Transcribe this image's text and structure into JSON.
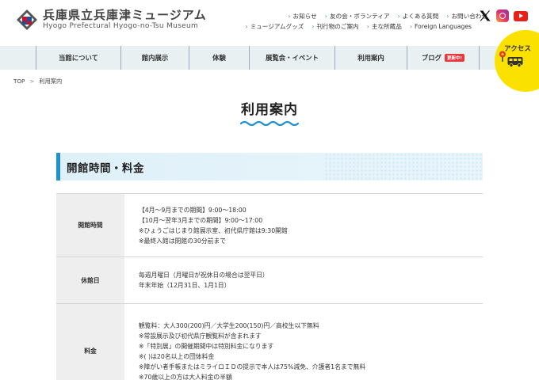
{
  "header": {
    "logo_jp": "兵庫県立兵庫津ミュージアム",
    "logo_en": "Hyogo Prefectural Hyogo-no-Tsu Museum",
    "util_links_row1": [
      "お知らせ",
      "友の会・ボランティア",
      "よくある質問",
      "お問い合わせ"
    ],
    "util_links_row2": [
      "ミュージアムグッズ",
      "刊行物のご案内",
      "主な所蔵品",
      "Foreign Languages"
    ],
    "sns": [
      "x-icon",
      "instagram-icon",
      "youtube-icon"
    ]
  },
  "gnav": {
    "items": [
      "当館について",
      "館内展示",
      "体験",
      "展覧会・イベント",
      "利用案内",
      "ブログ"
    ],
    "blog_badge": "更新中!"
  },
  "access": {
    "label": "アクセス"
  },
  "breadcrumb": {
    "home": "TOP",
    "separator": ">",
    "current": "利用案内"
  },
  "page": {
    "title": "利用案内"
  },
  "section": {
    "title": "開館時間・料金"
  },
  "table": {
    "rows": [
      {
        "label": "開館時間",
        "lines": [
          "【4月〜9月までの期間】9:00〜18:00",
          "【10月〜翌年3月までの期間】9:00〜17:00",
          "※ひょうごはじまり館展示室、初代県庁館は9:30開館",
          "※最終入館は閉館の30分前まで"
        ]
      },
      {
        "label": "休館日",
        "lines": [
          "毎週月曜日（月曜日が祝休日の場合は翌平日）",
          "年末年始（12月31日、1月1日）"
        ]
      },
      {
        "label": "料金",
        "lines": [
          "観覧料：大人300(200)円／大学生200(150)円／高校生以下無料",
          "※常設展示及び初代県庁観覧料が含まれます",
          "※「特別展」の開催期間中は特別料金になります",
          "※( )は20名以上の団体料金",
          "※障がい者手帳またはミライロＩＤの提示で本人は75%減免、介護者1名まで無料",
          "※70歳以上の方は大人料金の半額"
        ]
      }
    ]
  },
  "colors": {
    "accent_blue": "#1e93d2",
    "nav_bg": "#e8f0f2",
    "access_yellow": "#fbe100",
    "badge_red": "#e8383d"
  }
}
